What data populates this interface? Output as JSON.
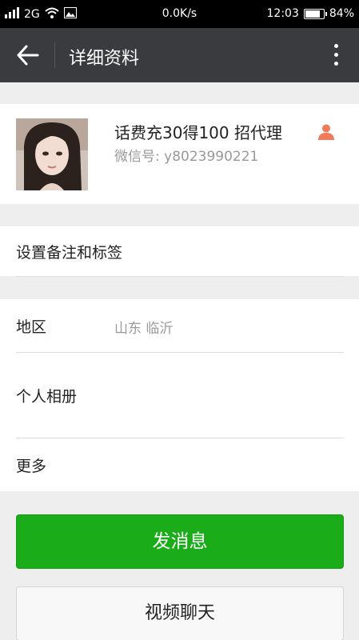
{
  "status_bar": {
    "network": "2G",
    "speed": "0.0K/s",
    "time": "12:03",
    "battery": "84%",
    "battery_level": 0.84
  },
  "header": {
    "title": "详细资料"
  },
  "profile": {
    "name": "话费充30得100  招代理",
    "wechat_id": "微信号: y8023990221"
  },
  "rows": {
    "remark": "设置备注和标签",
    "region_label": "地区",
    "region_value": "山东  临沂",
    "album": "个人相册",
    "more": "更多"
  },
  "buttons": {
    "send_message": "发消息",
    "video_chat": "视频聊天"
  },
  "colors": {
    "accent": "#1aad19",
    "topbar": "#3a3b3e",
    "person_icon": "#f07a5a"
  }
}
